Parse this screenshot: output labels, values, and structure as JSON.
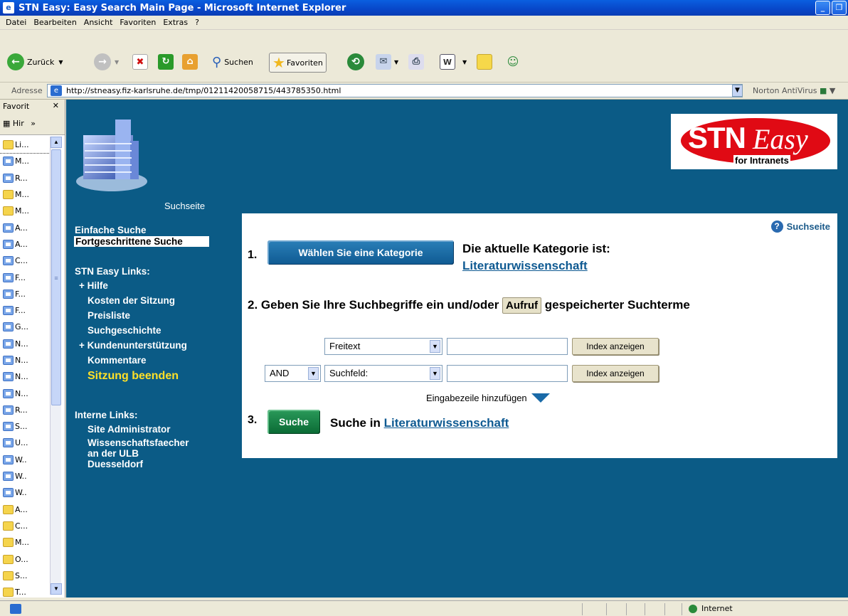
{
  "window": {
    "title": "STN Easy: Easy Search Main Page - Microsoft Internet Explorer"
  },
  "menu": [
    "Datei",
    "Bearbeiten",
    "Ansicht",
    "Favoriten",
    "Extras",
    "?"
  ],
  "toolbar": {
    "back": "Zurück",
    "search": "Suchen",
    "favorites": "Favoriten"
  },
  "address": {
    "label": "Adresse",
    "url": "http://stneasy.fiz-karlsruhe.de/tmp/01211420058715/443785350.html",
    "norton": "Norton AntiVirus"
  },
  "favorites": {
    "title": "Favorit",
    "history": "Hir",
    "items": [
      {
        "label": "Li...",
        "type": "folder"
      },
      {
        "label": "M...",
        "type": "page"
      },
      {
        "label": "R...",
        "type": "page"
      },
      {
        "label": "M...",
        "type": "folder"
      },
      {
        "label": "M...",
        "type": "folder"
      },
      {
        "label": "A...",
        "type": "page"
      },
      {
        "label": "A...",
        "type": "page"
      },
      {
        "label": "C...",
        "type": "page"
      },
      {
        "label": "F...",
        "type": "page"
      },
      {
        "label": "F...",
        "type": "page"
      },
      {
        "label": "F...",
        "type": "page"
      },
      {
        "label": "G...",
        "type": "page"
      },
      {
        "label": "N...",
        "type": "page"
      },
      {
        "label": "N...",
        "type": "page"
      },
      {
        "label": "N...",
        "type": "page"
      },
      {
        "label": "N...",
        "type": "page"
      },
      {
        "label": "R...",
        "type": "page"
      },
      {
        "label": "S...",
        "type": "page"
      },
      {
        "label": "U...",
        "type": "page"
      },
      {
        "label": "W..",
        "type": "page"
      },
      {
        "label": "W..",
        "type": "page"
      },
      {
        "label": "W..",
        "type": "page"
      },
      {
        "label": "A...",
        "type": "folder"
      },
      {
        "label": "C...",
        "type": "folder"
      },
      {
        "label": "M...",
        "type": "folder"
      },
      {
        "label": "O...",
        "type": "folder"
      },
      {
        "label": "S...",
        "type": "folder"
      },
      {
        "label": "T...",
        "type": "folder"
      }
    ]
  },
  "page": {
    "logo_caption": "Suchseite",
    "stn_logo": {
      "stn": "STN",
      "easy": "Easy",
      "sub": "for Intranets"
    },
    "nav": {
      "einfache": "Einfache Suche",
      "fortgeschrittene": "Fortgeschrittene Suche",
      "links_title": "STN Easy Links:",
      "hilfe": "+ Hilfe",
      "kosten": "Kosten der Sitzung",
      "preisliste": "Preisliste",
      "suchgeschichte": "Suchgeschichte",
      "kunden": "+ Kundenunterstützung",
      "kommentare": "Kommentare",
      "beenden": "Sitzung beenden",
      "intern_title": "Interne Links:",
      "admin": "Site Administrator",
      "wiss1": "Wissenschaftsfaecher",
      "wiss2": "an der ULB",
      "wiss3": "Duesseldorf"
    },
    "help": "Suchseite",
    "step1": {
      "num": "1.",
      "button": "Wählen Sie eine Kategorie",
      "text": "Die aktuelle Kategorie ist:",
      "category": "Literaturwissenschaft"
    },
    "step2": {
      "num": "2.",
      "pre": "Geben Sie Ihre Suchbegriffe ein und/oder",
      "button": "Aufruf",
      "post": "gespeicherter Suchterme"
    },
    "rows": {
      "field1": "Freitext",
      "op": "AND",
      "field2": "Suchfeld:",
      "index_btn": "Index anzeigen"
    },
    "add_row": "Eingabezeile hinzufügen",
    "step3": {
      "num": "3.",
      "button": "Suche",
      "pre": "Suche in",
      "category": "Literaturwissenschaft"
    }
  },
  "status": {
    "zone": "Internet"
  }
}
